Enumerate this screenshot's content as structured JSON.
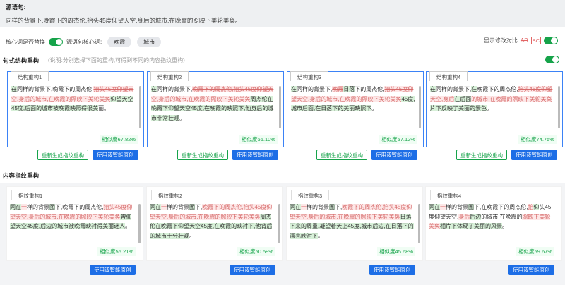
{
  "source": {
    "title": "源语句:",
    "text": "同样的背景下,晚霞下的周杰伦,抬头45度仰望天空,身后的城市,在晚霞的照映下美轮美奂。"
  },
  "options": {
    "core_replace_label": "核心词是否替换",
    "source_core_label": "源语句核心词:",
    "keywords": [
      "晚霞",
      "城市"
    ],
    "diff_label": "显示修改对比",
    "diff_del_sample": "AB",
    "diff_add_sample": "BC"
  },
  "structure_section": {
    "title": "句式结构重构",
    "note": "(说明:分别选择下面的重构,可得到不同的内容指纹重构)",
    "cards": [
      {
        "label": "结构重构1",
        "segments": [
          {
            "t": "在",
            "c": "ins ul"
          },
          {
            "t": "同样的背景下,晚霞下的周杰伦,"
          },
          {
            "t": "抬头45度仰望天空,身后的城市,在晚霞的照映下美轮美奂",
            "c": "del"
          },
          {
            "t": "仰望天空45度,后面的城市被晚霞映照得很美",
            "c": "ins"
          },
          {
            "t": "丽。"
          }
        ],
        "similarity": "相似度67.82%"
      },
      {
        "label": "结构重构2",
        "segments": [
          {
            "t": "在",
            "c": "ins ul"
          },
          {
            "t": "同样的背景下,"
          },
          {
            "t": "晚霞下的周杰伦,抬头45度仰望天空,身后的城市,在晚霞的照映下美轮美奂",
            "c": "del"
          },
          {
            "t": "周杰伦在晚霞下仰望天空45度,在晚霞的映照下,他身后的城市非常壮观",
            "c": "ins"
          },
          {
            "t": "。"
          }
        ],
        "similarity": "相似度65.10%"
      },
      {
        "label": "结构重构3",
        "segments": [
          {
            "t": "在",
            "c": "ins ul"
          },
          {
            "t": "同样的背景下,"
          },
          {
            "t": "晚霞",
            "c": "del"
          },
          {
            "t": "日落",
            "c": "ins ul"
          },
          {
            "t": "下的周杰伦,"
          },
          {
            "t": "抬头45度仰望天空,身后的城市,在晚霞的照映下美轮美奂",
            "c": "del"
          },
          {
            "t": "45度,城市后面,在日落下的美丽映照下",
            "c": "ins"
          },
          {
            "t": "。"
          }
        ],
        "similarity": "相似度57.12%"
      },
      {
        "label": "结构重构4",
        "segments": [
          {
            "t": "在",
            "c": "ins ul"
          },
          {
            "t": "同样的背景下,"
          },
          {
            "t": "在",
            "c": "ins ul"
          },
          {
            "t": "晚霞下的周杰伦,"
          },
          {
            "t": "抬头45度仰望天空,",
            "c": "del"
          },
          {
            "t": "身后",
            "c": "del"
          },
          {
            "t": "在后面",
            "c": "ins"
          },
          {
            "t": "的城市,在晚霞的照映下美轮美奂",
            "c": "del"
          },
          {
            "t": "片下反映了美丽的景色",
            "c": "ins"
          },
          {
            "t": "。"
          }
        ],
        "similarity": "相似度74.75%"
      }
    ],
    "regen_label": "重新生成指纹重构",
    "use_label": "使用该智能原创"
  },
  "content_section": {
    "title": "内容指纹重构",
    "cards": [
      {
        "label": "指纹重构1",
        "segments": [
          {
            "t": "同在",
            "c": "ins ul"
          },
          {
            "t": "一",
            "c": "del"
          },
          {
            "t": "样的背景"
          },
          {
            "t": "图",
            "c": "ins"
          },
          {
            "t": "下,晚霞下的周杰伦,"
          },
          {
            "t": "抬头45度仰望天空,身后的城市,在晚霞的照映下美轮美奂",
            "c": "del"
          },
          {
            "t": "曾仰望天空45度,后边的城市被晚霞映衬得美丽迷人",
            "c": "ins"
          },
          {
            "t": "。"
          }
        ],
        "similarity": "相似度55.21%"
      },
      {
        "label": "指纹重构2",
        "segments": [
          {
            "t": "同在",
            "c": "ins ul"
          },
          {
            "t": "一",
            "c": "del"
          },
          {
            "t": "样的背景"
          },
          {
            "t": "图",
            "c": "ins"
          },
          {
            "t": "下,"
          },
          {
            "t": "晚霞下的周杰伦,抬头45度仰望天空,身后的城市,在晚霞的照映下美轮美奂",
            "c": "del"
          },
          {
            "t": "周杰伦在晚霞下仰望天空45度,在晚霞的映衬下,他背后的城市十分壮观",
            "c": "ins"
          },
          {
            "t": "。"
          }
        ],
        "similarity": "相似度50.59%"
      },
      {
        "label": "指纹重构3",
        "segments": [
          {
            "t": "同在",
            "c": "ins ul"
          },
          {
            "t": "一",
            "c": "del"
          },
          {
            "t": "样的背景"
          },
          {
            "t": "图",
            "c": "ins"
          },
          {
            "t": "下,"
          },
          {
            "t": "晚霞下的周杰伦,抬头45度仰望天空,身后的城市,在晚霞的照映下美轮美奂",
            "c": "del"
          },
          {
            "t": "日落下来的周重,凝望着天上45度,城市后边,在日落下的漂亮映衬下",
            "c": "ins"
          },
          {
            "t": "。"
          }
        ],
        "similarity": "相似度45.68%"
      },
      {
        "label": "指纹重构4",
        "segments": [
          {
            "t": "同在",
            "c": "ins ul"
          },
          {
            "t": "一",
            "c": "del"
          },
          {
            "t": "样的背景"
          },
          {
            "t": "图",
            "c": "ins"
          },
          {
            "t": "下,在晚霞下的周杰伦,"
          },
          {
            "t": "抬",
            "c": "del"
          },
          {
            "t": "仰",
            "c": "ins ul"
          },
          {
            "t": "头45度仰望天空,"
          },
          {
            "t": "身后",
            "c": "del"
          },
          {
            "t": "后边",
            "c": "ins"
          },
          {
            "t": "的城市,在晚霞的"
          },
          {
            "t": "照映下美轮美奂",
            "c": "del"
          },
          {
            "t": "相片下体现了美丽的风景",
            "c": "ins"
          },
          {
            "t": "。"
          }
        ],
        "similarity": "相似度59.67%"
      }
    ],
    "use_label": "使用该智能原创"
  }
}
